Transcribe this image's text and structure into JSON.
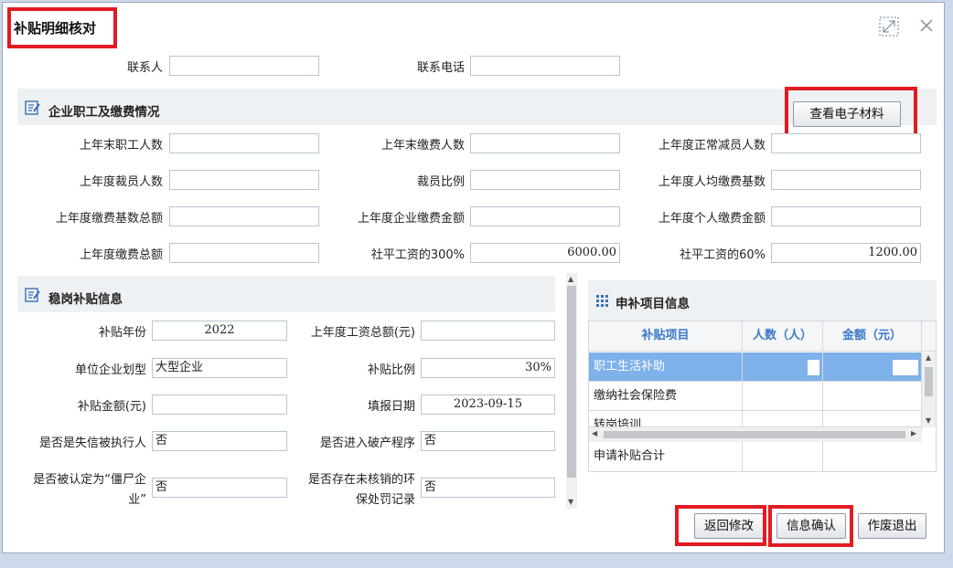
{
  "dialog": {
    "title": "补贴明细核对"
  },
  "contact": {
    "person_label": "联系人",
    "person_value": "",
    "phone_label": "联系电话",
    "phone_value": ""
  },
  "employee_section": {
    "title": "企业职工及缴费情况",
    "view_materials_button": "查看电子材料",
    "fields": [
      {
        "label": "上年末职工人数",
        "value": ""
      },
      {
        "label": "上年末缴费人数",
        "value": ""
      },
      {
        "label": "上年度正常减员人数",
        "value": ""
      },
      {
        "label": "上年度裁员人数",
        "value": ""
      },
      {
        "label": "裁员比例",
        "value": ""
      },
      {
        "label": "上年度人均缴费基数",
        "value": ""
      },
      {
        "label": "上年度缴费基数总额",
        "value": ""
      },
      {
        "label": "上年度企业缴费金额",
        "value": ""
      },
      {
        "label": "上年度个人缴费金额",
        "value": ""
      },
      {
        "label": "上年度缴费总额",
        "value": ""
      },
      {
        "label": "社平工资的300%",
        "value": "6000.00"
      },
      {
        "label": "社平工资的60%",
        "value": "1200.00"
      }
    ]
  },
  "subsidy_section": {
    "title": "稳岗补贴信息",
    "fields": [
      {
        "label": "补贴年份",
        "value": "2022"
      },
      {
        "label": "上年度工资总额(元)",
        "value": ""
      },
      {
        "label": "单位企业划型",
        "value": "大型企业"
      },
      {
        "label": "补贴比例",
        "value": "30%"
      },
      {
        "label": "补贴金额(元)",
        "value": ""
      },
      {
        "label": "填报日期",
        "value": "2023-09-15"
      },
      {
        "label": "是否是失信被执行人",
        "value": "否"
      },
      {
        "label": "是否进入破产程序",
        "value": "否"
      },
      {
        "label": "是否被认定为“僵尸企",
        "label2": "业”",
        "value": "否"
      },
      {
        "label": "是否存在未核销的环",
        "label2": "保处罚记录",
        "value": "否"
      }
    ]
  },
  "apply_section": {
    "title": "申补项目信息",
    "columns": [
      "补贴项目",
      "人数（人）",
      "金额（元）"
    ],
    "rows": [
      {
        "item": "职工生活补助",
        "count": "",
        "amount": ""
      },
      {
        "item": "缴纳社会保险费",
        "count": "",
        "amount": ""
      },
      {
        "item": "转岗培训",
        "count": "",
        "amount": ""
      }
    ],
    "total_label": "申请补贴合计"
  },
  "footer": {
    "return_button": "返回修改",
    "confirm_button": "信息确认",
    "cancel_button": "作废退出"
  },
  "colors": {
    "highlight": "#e21b22",
    "selected_row": "#7fb1ea",
    "header_text": "#3a78c7"
  }
}
